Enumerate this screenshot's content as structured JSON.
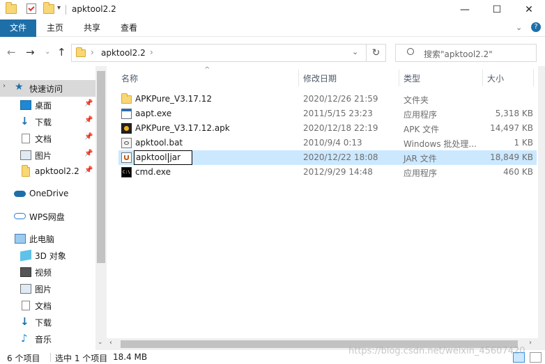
{
  "window": {
    "title": "apktool2.2",
    "minimize": "—",
    "maximize": "☐",
    "close": "✕",
    "help": "?",
    "collapse": "⌄"
  },
  "ribbon": {
    "tabs": [
      "文件",
      "主页",
      "共享",
      "查看"
    ]
  },
  "address": {
    "path": "apktool2.2",
    "search_placeholder": "搜索\"apktool2.2\""
  },
  "sidebar": {
    "quick_access": "快速访问",
    "items": [
      {
        "label": "桌面",
        "pinned": true,
        "icon": "desktop-icon"
      },
      {
        "label": "下载",
        "pinned": true,
        "icon": "download-icon"
      },
      {
        "label": "文档",
        "pinned": true,
        "icon": "document-icon"
      },
      {
        "label": "图片",
        "pinned": true,
        "icon": "picture-icon"
      },
      {
        "label": "apktool2.2",
        "pinned": true,
        "icon": "folder-icon"
      }
    ],
    "onedrive": "OneDrive",
    "wps": "WPS网盘",
    "this_pc": "此电脑",
    "pc_items": [
      {
        "label": "3D 对象",
        "icon": "3d-objects-icon"
      },
      {
        "label": "视频",
        "icon": "video-icon"
      },
      {
        "label": "图片",
        "icon": "picture-icon"
      },
      {
        "label": "文档",
        "icon": "document-icon"
      },
      {
        "label": "下载",
        "icon": "download-icon"
      },
      {
        "label": "音乐",
        "icon": "music-icon"
      }
    ]
  },
  "columns": {
    "name": "名称",
    "date": "修改日期",
    "type": "类型",
    "size": "大小"
  },
  "files": [
    {
      "name": "APKPure_V3.17.12",
      "date": "2020/12/26 21:59",
      "type": "文件夹",
      "size": "",
      "icon": "folder-icon"
    },
    {
      "name": "aapt.exe",
      "date": "2011/5/15 23:23",
      "type": "应用程序",
      "size": "5,318 KB",
      "icon": "exe-icon"
    },
    {
      "name": "APKPure_V3.17.12.apk",
      "date": "2020/12/18 22:19",
      "type": "APK 文件",
      "size": "14,497 KB",
      "icon": "apk-icon"
    },
    {
      "name": "apktool.bat",
      "date": "2010/9/4 0:13",
      "type": "Windows 批处理...",
      "size": "1 KB",
      "icon": "bat-icon"
    },
    {
      "name": "apktool.jar",
      "date": "2020/12/22 18:08",
      "type": "JAR 文件",
      "size": "18,849 KB",
      "icon": "jar-icon",
      "selected": true,
      "renaming": true
    },
    {
      "name": "cmd.exe",
      "date": "2012/9/29 14:48",
      "type": "应用程序",
      "size": "460 KB",
      "icon": "cmd-icon"
    }
  ],
  "status": {
    "count": "6 个项目",
    "selected": "选中 1 个项目",
    "size": "18.4 MB"
  },
  "watermark": "https://blog.csdn.net/weixin_45607420",
  "colors": {
    "accent": "#1e6fa8",
    "selection": "#cce8ff",
    "folder": "#f8d775"
  }
}
